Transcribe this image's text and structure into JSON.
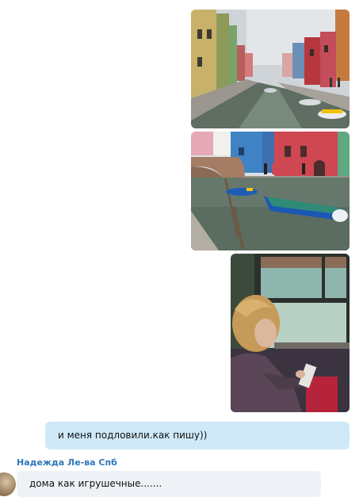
{
  "messages": {
    "outgoing_text": "и меня подловили.как пишу))",
    "incoming_sender": "Надежда Ле-ва Спб",
    "incoming_text": "дома как игрушечные......."
  },
  "colors": {
    "outgoing_bubble": "#cfe9f9",
    "incoming_bubble": "#eef2f6",
    "sender_name": "#2f78b6"
  }
}
